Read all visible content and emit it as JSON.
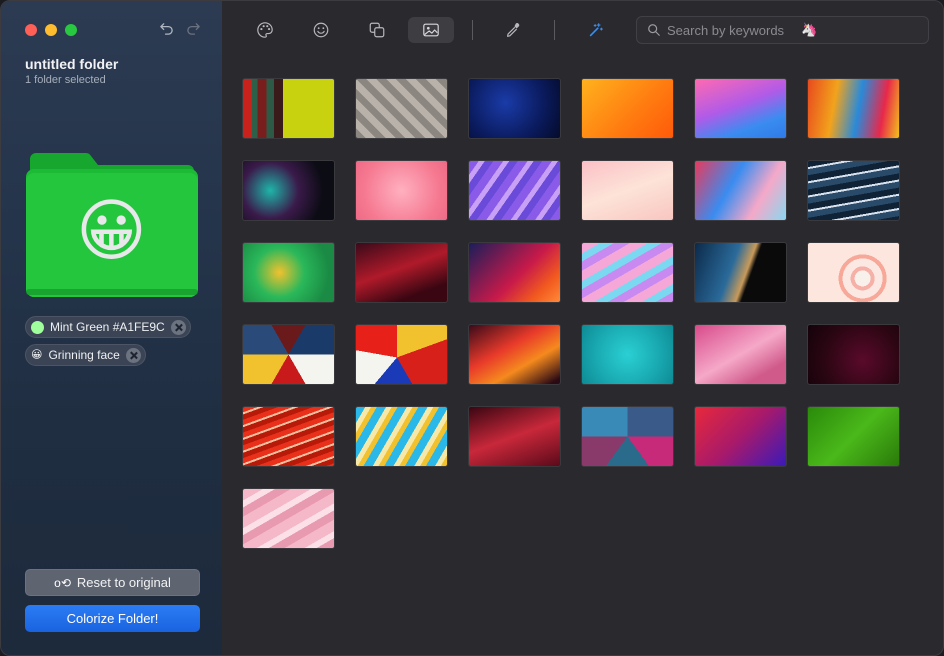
{
  "sidebar": {
    "title": "untitled folder",
    "subtitle": "1 folder selected",
    "folder_color": "#1fc23a",
    "folder_emoji": "😀",
    "tags": [
      {
        "label": "Mint Green #A1FE9C",
        "color": "#A1FE9C"
      },
      {
        "label": "Grinning face",
        "emoji": "😀"
      }
    ],
    "reset_label": "Reset to original",
    "colorize_label": "Colorize Folder!"
  },
  "toolbar": {
    "icons": [
      "palette-icon",
      "emoji-icon",
      "shapes-icon",
      "image-icon",
      "eyedropper-icon",
      "magic-wand-icon"
    ],
    "active": "image-icon"
  },
  "search": {
    "placeholder": "Search by keywords",
    "emoji": "🦄"
  },
  "wallpapers": [
    {
      "bg": "linear-gradient(90deg,#c9221c 0 10%,#2d6048 10% 16%,#7a1d1d 16% 26%,#2c5a46 26% 34%,#3a1a1a 34% 44%,#c9d20f 44% 100%)"
    },
    {
      "bg": "repeating-linear-gradient(45deg,#8c8680 0 7px,#b8b2aa 7px 14px),#999"
    },
    {
      "bg": "radial-gradient(circle at 40% 40%,#1a3ba8,#0a1a5c 60%,#050b2a)"
    },
    {
      "bg": "linear-gradient(135deg,#ffb21e,#ff7a10 60%,#ff5a0a)"
    },
    {
      "bg": "linear-gradient(160deg,#ff6ab0 0%,#b05be8 45%,#3a8cf0 75%,#2f7ae8 100%)"
    },
    {
      "bg": "linear-gradient(100deg,#e84a1e,#f2a31c 30%,#2a8ad8 55%,#e8284a 80%,#f3c11c)"
    },
    {
      "bg": "radial-gradient(circle at 30% 50%,#1fb5a8,#3a1a4a 40%,#0c0c14 75%)"
    },
    {
      "bg": "radial-gradient(circle at 50% 50%,#ffb0c0,#f57890 70%,#ee6a86)"
    },
    {
      "bg": "repeating-linear-gradient(125deg,#8a5ae8 0 8px,#c8a0f5 8px 13px,#6a4ad8 13px 20px)"
    },
    {
      "bg": "linear-gradient(160deg,#fbc0c6,#fde3d8 50%,#f8c6c0)"
    },
    {
      "bg": "linear-gradient(120deg,#e83a5c,#3a8cf0 40%,#f5a8c8 70%,#8ad8f0)"
    },
    {
      "bg": "repeating-linear-gradient(170deg,#0f2236 0 6px,#d8e2ee 6px 8px,#2a4a6a 8px 14px)"
    },
    {
      "bg": "radial-gradient(circle at 40% 50%,#f2c12e,#2ab85a 40%,#1a8a44 80%)"
    },
    {
      "bg": "linear-gradient(160deg,#3a0a1a,#b01a2a 45%,#3a0612 80%)"
    },
    {
      "bg": "linear-gradient(135deg,#1a1e5a,#c81a4a 55%,#f25a1e 80%,#ff8a3a)"
    },
    {
      "bg": "repeating-linear-gradient(150deg,#f5a8d8 0 9px,#7ad8f0 9px 16px,#c88af0 16px 24px)"
    },
    {
      "bg": "linear-gradient(110deg,#0c2a4a 0%,#2a6a9a 40%,#c89a5a 55%,#0a0a0a 60%)"
    },
    {
      "bg": "radial-gradient(circle at 60% 60%,#f8f0ea 0 8px,#f5b0a8 8px 12px,#fbe8e2 12px 20px,#f7a898 20px 24px,#fde6de 24px)"
    },
    {
      "bg": "conic-gradient(from 30deg at 50% 50%,#1a3a6a 0 60deg,#f5f5f0 60deg 120deg,#c81a1a 120deg 180deg,#f2c12e 180deg 240deg,#2a4a7a 240deg 300deg,#6a1a1a 300deg)"
    },
    {
      "bg": "conic-gradient(from 0deg at 45% 55%,#f2c12e 0 70deg,#d8201a 70deg 150deg,#1a3ab8 150deg 220deg,#f5f5f0 220deg 280deg,#e8201a 280deg)"
    },
    {
      "bg": "linear-gradient(150deg,#3a0a1a,#e83a2a 40%,#f58a1e 65%,#2a0a14 95%)"
    },
    {
      "bg": "radial-gradient(circle at 50% 50%,#2ad0d4,#19a8b0 60%,#0e8a94)"
    },
    {
      "bg": "linear-gradient(150deg,#d84a8a,#f5a8c8 50%,#d05a8a 80%)"
    },
    {
      "bg": "radial-gradient(circle at 60% 60%,#5a0a2a,#2a0612 60%,#14020a)"
    },
    {
      "bg": "repeating-linear-gradient(160deg,#e8301a 0 5px,#f5c0a0 5px 7px,#b81a0a 7px 12px)"
    },
    {
      "bg": "repeating-linear-gradient(120deg,#2ab8e8 0 8px,#f5e8a8 8px 13px,#f2c12e 13px 18px)"
    },
    {
      "bg": "linear-gradient(160deg,#3a0612,#c8283a 50%,#5a0a1a)"
    },
    {
      "bg": "conic-gradient(#3a5a8a 0 25%,#c82a7a 25% 40%,#2a6a8a 40% 60%,#8a3a6a 60% 75%,#3a8ab8 75%)"
    },
    {
      "bg": "linear-gradient(135deg,#e8283a,#a81a6a 50%,#3a1ab8 100%)"
    },
    {
      "bg": "linear-gradient(135deg,#2a8a0a,#4ab81a 50%,#2a7a0a)"
    },
    {
      "bg": "repeating-linear-gradient(150deg,#f5b8c8 0 10px,#fbe0e8 10px 16px,#e89ab0 16px 24px)"
    }
  ]
}
